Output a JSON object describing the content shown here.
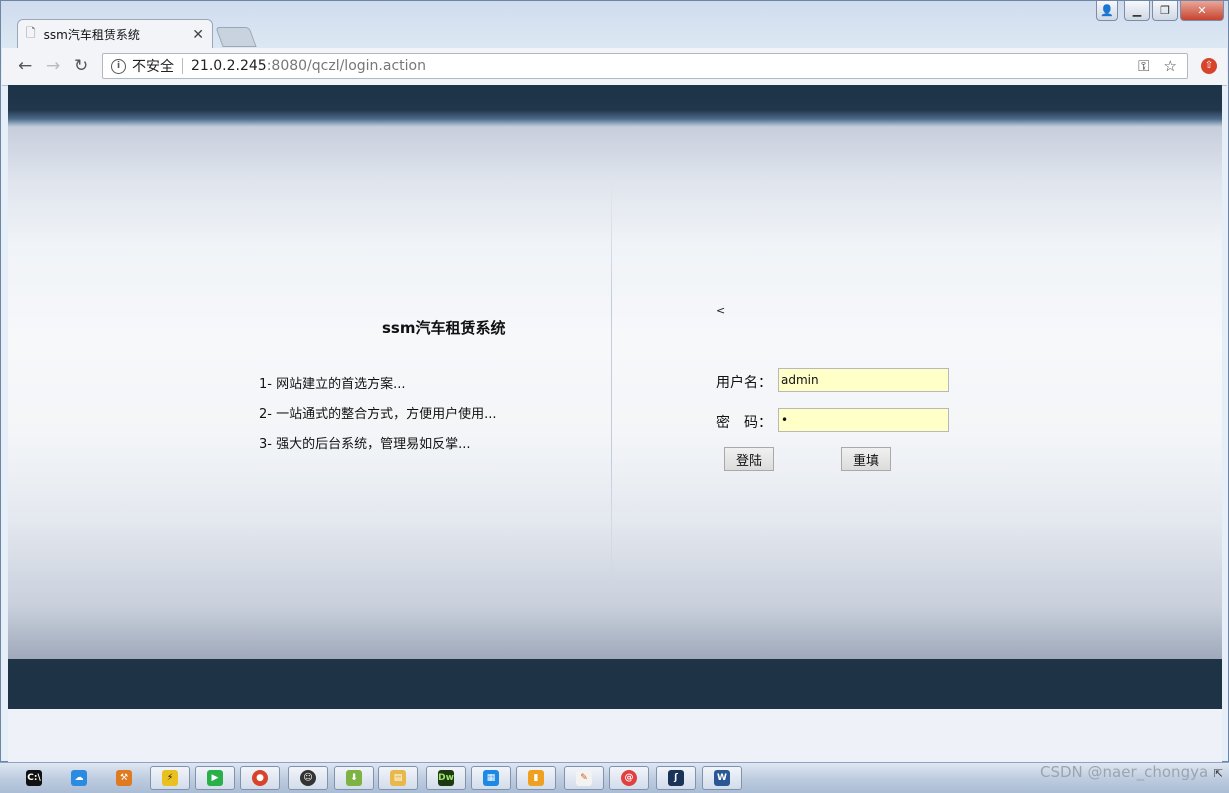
{
  "browser": {
    "tab_title": "ssm汽车租赁系统",
    "tab_close": "✕",
    "security_label": "不安全",
    "url_host": "21.0.2.245",
    "url_rest": ":8080/qczl/login.action"
  },
  "page": {
    "system_title": "ssm汽车租赁系统",
    "features": [
      "1- 网站建立的首选方案...",
      "2- 一站通式的整合方式，方便用户使用...",
      "3- 强大的后台系统，管理易如反掌..."
    ],
    "small_mark": "<",
    "username_label": "用户名：",
    "password_label": "密　码：",
    "username_value": "admin",
    "password_value": "•",
    "login_button": "登陆",
    "reset_button": "重填"
  },
  "taskbar": {
    "items": [
      "cmd-icon",
      "cloud-icon",
      "tool-icon",
      "plugin-icon",
      "player-icon",
      "chrome-icon",
      "avatar-icon",
      "download-icon",
      "folder-icon",
      "dreamweaver-icon",
      "grid-icon",
      "app-icon",
      "pin-icon",
      "snail-icon",
      "eclipse-icon",
      "word-icon"
    ],
    "dw_label": "Dw"
  },
  "watermark": "CSDN @naer_chongya",
  "colors": {
    "header_band": "#1e3346",
    "input_bg": "#ffffc8",
    "close_button": "#c7432f"
  }
}
